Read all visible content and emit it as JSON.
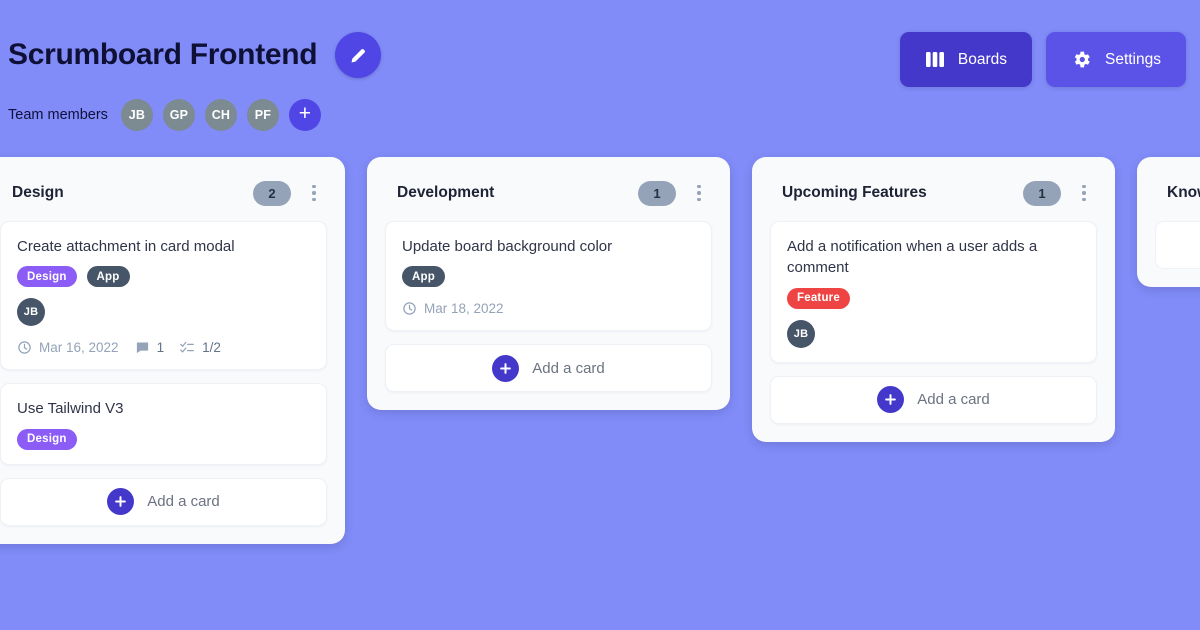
{
  "header": {
    "board_title": "Scrumboard Frontend",
    "edit_icon": "pencil-icon",
    "members_label": "Team members",
    "members": [
      {
        "initials": "JB"
      },
      {
        "initials": "GP"
      },
      {
        "initials": "CH"
      },
      {
        "initials": "PF"
      }
    ],
    "add_member_glyph": "+",
    "actions": [
      {
        "label": "Boards",
        "icon": "columns-icon",
        "color": "#4338ca"
      },
      {
        "label": "Settings",
        "icon": "gear-icon",
        "color": "#5b53e8"
      }
    ]
  },
  "board": {
    "add_card_label": "Add a card",
    "columns": [
      {
        "title": "Design",
        "count": "2",
        "cards": [
          {
            "title": "Create attachment in card modal",
            "tags": [
              {
                "label": "Design",
                "color": "#8b5cf6"
              },
              {
                "label": "App",
                "color": "#475569"
              }
            ],
            "avatars": [
              {
                "initials": "JB"
              }
            ],
            "meta": {
              "date": "Mar 16, 2022",
              "comments": "1",
              "checklist": "1/2"
            }
          },
          {
            "title": "Use Tailwind V3",
            "tags": [
              {
                "label": "Design",
                "color": "#8b5cf6"
              }
            ],
            "avatars": [],
            "meta": null
          }
        ]
      },
      {
        "title": "Development",
        "count": "1",
        "cards": [
          {
            "title": "Update board background color",
            "tags": [
              {
                "label": "App",
                "color": "#475569"
              }
            ],
            "avatars": [],
            "meta": {
              "date": "Mar 18, 2022",
              "comments": null,
              "checklist": null
            }
          }
        ]
      },
      {
        "title": "Upcoming Features",
        "count": "1",
        "cards": [
          {
            "title": "Add a notification when a user adds a comment",
            "tags": [
              {
                "label": "Feature",
                "color": "#ef4444"
              }
            ],
            "avatars": [
              {
                "initials": "JB"
              }
            ],
            "meta": null
          }
        ]
      },
      {
        "title": "Known Bugs",
        "count": null,
        "cards": []
      }
    ]
  },
  "colors": {
    "page_background": "#818cf8",
    "column_background": "#f8fafc",
    "accent": "#4f46e5"
  }
}
